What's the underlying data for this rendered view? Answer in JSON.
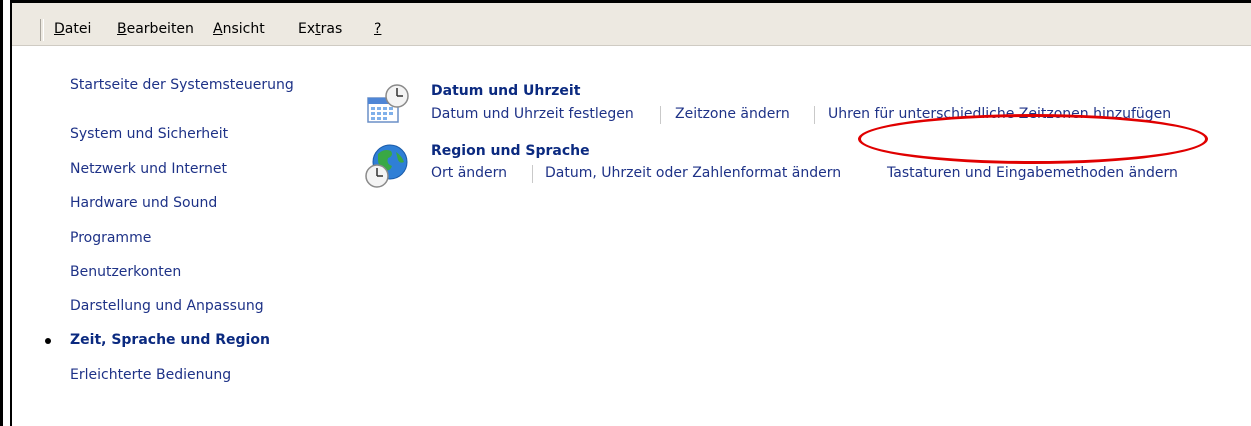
{
  "menubar": {
    "items": [
      "Datei",
      "Bearbeiten",
      "Ansicht",
      "Extras",
      "?"
    ],
    "underline_chars": [
      "D",
      "B",
      "A",
      "t",
      "?"
    ]
  },
  "sidebar": {
    "home": "Startseite der Systemsteuerung",
    "items": [
      "System und Sicherheit",
      "Netzwerk und Internet",
      "Hardware und Sound",
      "Programme",
      "Benutzerkonten",
      "Darstellung und Anpassung",
      "Zeit, Sprache und Region",
      "Erleichterte Bedienung"
    ],
    "active_index": 6
  },
  "categories": [
    {
      "title": "Datum und Uhrzeit",
      "icon": "calendar-clock-icon",
      "tasks": [
        "Datum und Uhrzeit festlegen",
        "Zeitzone ändern",
        "Uhren für unterschiedliche Zeitzonen hinzufügen"
      ]
    },
    {
      "title": "Region und Sprache",
      "icon": "globe-clock-icon",
      "tasks": [
        "Ort ändern",
        "Datum, Uhrzeit oder Zahlenformat ändern",
        "Tastaturen und Eingabemethoden ändern"
      ]
    }
  ],
  "annotation": {
    "shape": "ellipse",
    "color": "#e00000",
    "highlights": "Tastaturen und Eingabemethoden ändern"
  },
  "colors": {
    "link": "#1e3287",
    "heading": "#0b2a80",
    "menubar_bg": "#ede9e1"
  }
}
